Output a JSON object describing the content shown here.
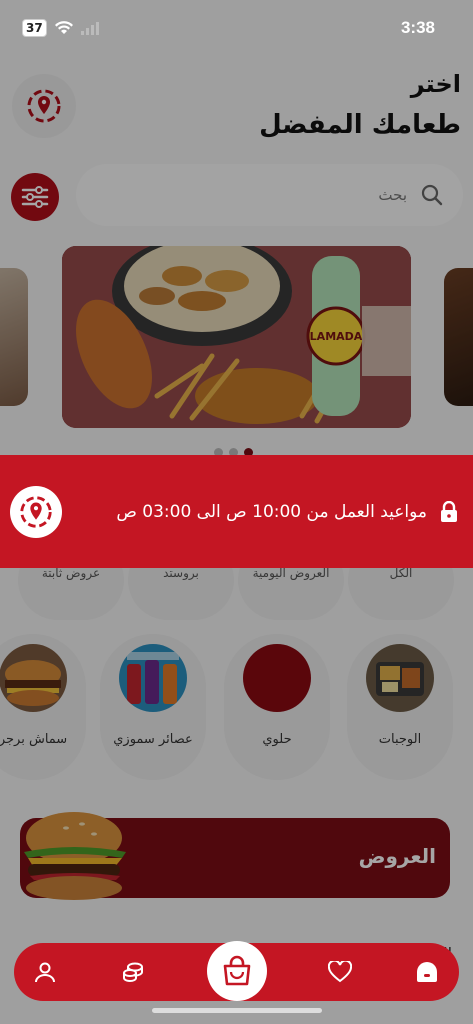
{
  "status_bar": {
    "battery": "37",
    "time": "3:38"
  },
  "header": {
    "title_line1": "اختر",
    "title_line2": "طعامك المفضل"
  },
  "search": {
    "placeholder": "بحث"
  },
  "carousel": {
    "banner_brand": "LAMADA",
    "dots": 3,
    "active_dot": 2
  },
  "categories_row1": [
    "عروض ثابتة",
    "بروستد",
    "العروض اليومية",
    "الكل"
  ],
  "categories_row2": [
    {
      "label": "سماش برجر",
      "icon": "burger-image"
    },
    {
      "label": "عصائر سموزي",
      "icon": "juice-image"
    },
    {
      "label": "حلوي",
      "icon": "dessert-image"
    },
    {
      "label": "الوجبات",
      "icon": "meal-image"
    }
  ],
  "offers": {
    "label": "العروض"
  },
  "hours_banner": {
    "text": "مواعيد العمل من 10:00 ص الى 03:00 ص"
  },
  "bottom_nav": {
    "items": [
      "profile-icon",
      "coins-icon",
      "shopping-bag-icon",
      "heart-icon",
      "home-icon"
    ]
  },
  "colors": {
    "brand_red": "#c41623",
    "dark_red": "#7c0d15"
  }
}
